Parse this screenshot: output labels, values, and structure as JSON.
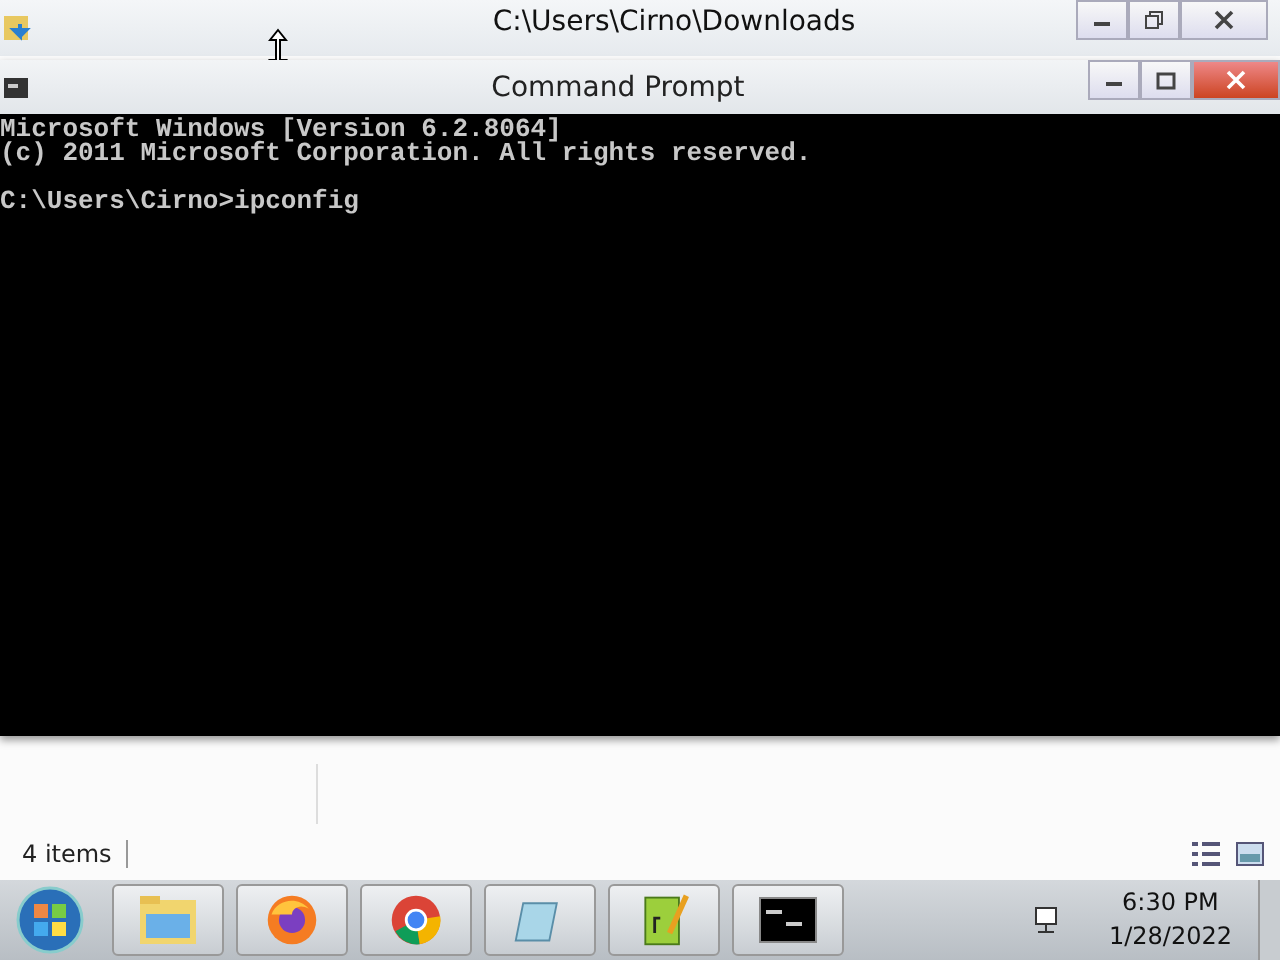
{
  "explorer": {
    "title": "C:\\Users\\Cirno\\Downloads",
    "status": "4 items"
  },
  "console": {
    "title": "Command Prompt",
    "blocks": [
      [
        "Microsoft Windows [Version 6.2.8064]",
        "(c) 2011 Microsoft Corporation. All rights reserved."
      ],
      [
        "C:\\Users\\Cirno>ipconfig"
      ]
    ]
  },
  "taskbar": {
    "items": [
      {
        "kind": "explorer"
      },
      {
        "kind": "firefox"
      },
      {
        "kind": "chrome"
      },
      {
        "kind": "notepad"
      },
      {
        "kind": "notepadpp"
      },
      {
        "kind": "console"
      }
    ],
    "time": "6:30 PM",
    "date": "1/28/2022"
  }
}
